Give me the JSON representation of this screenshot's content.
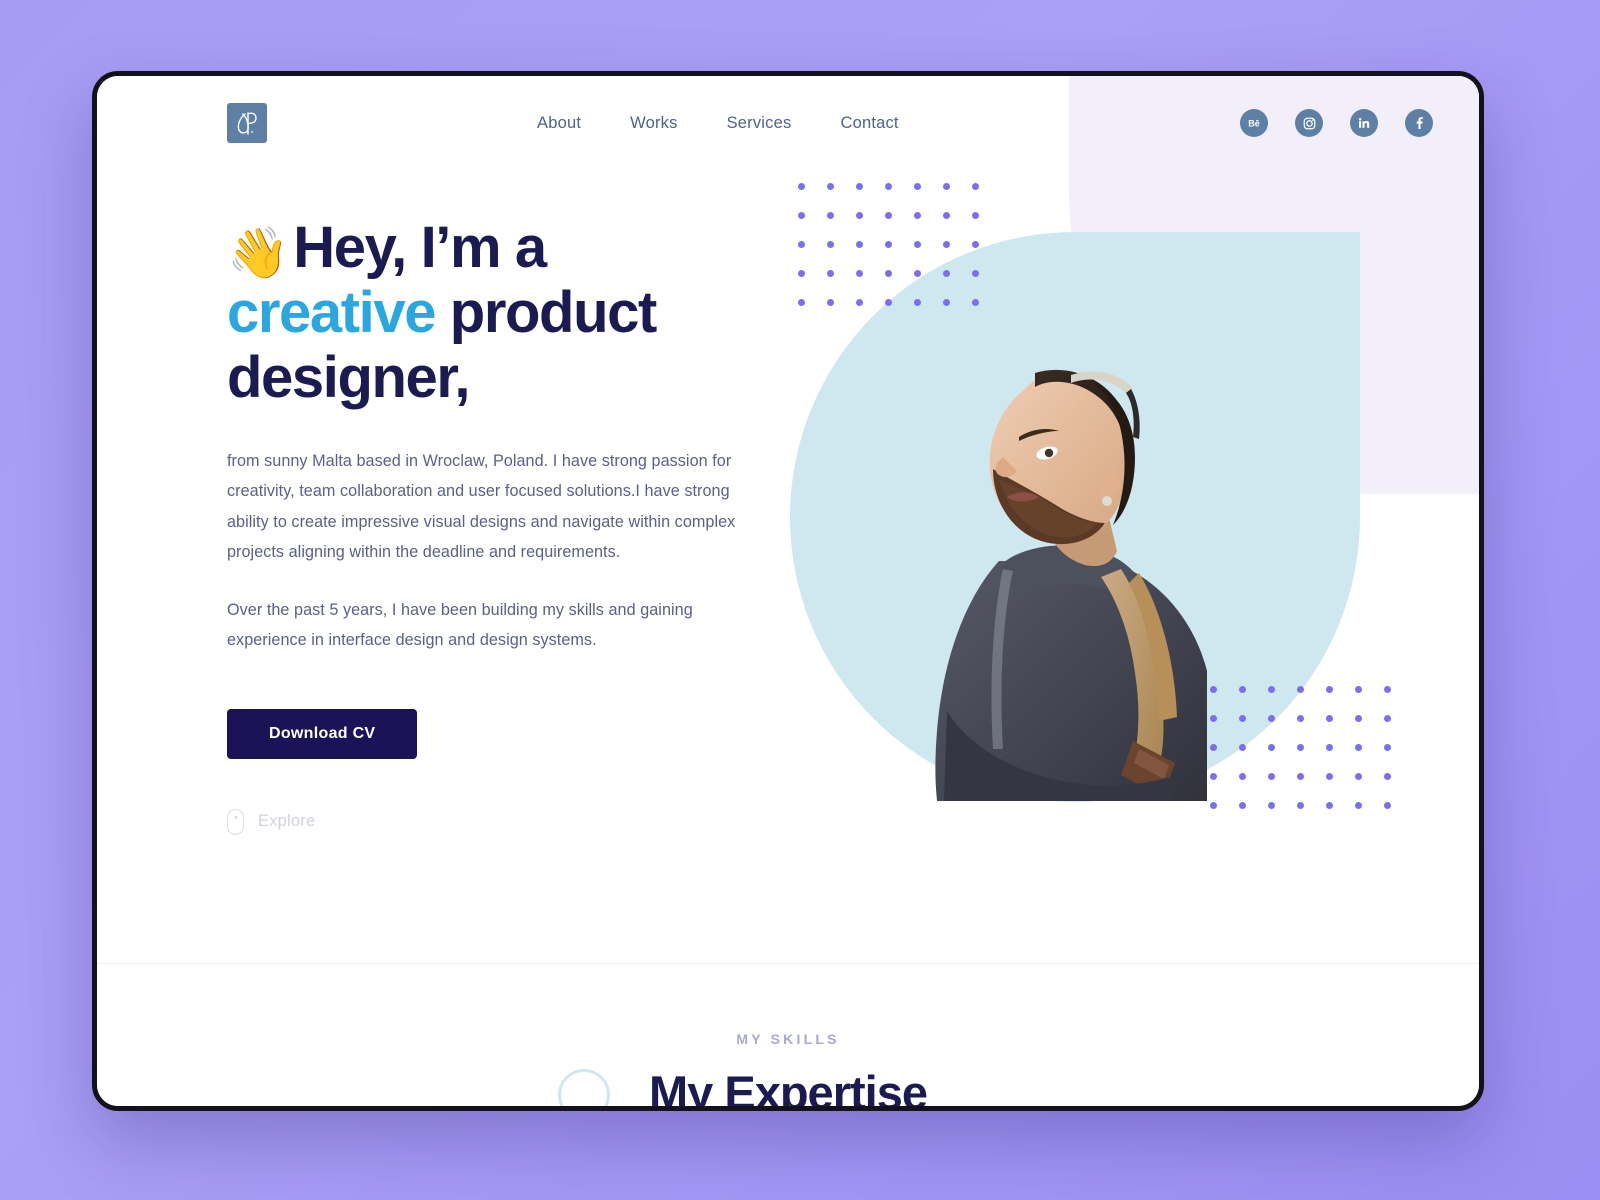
{
  "page": {
    "background_color": "#a79cf5",
    "frame_border_color": "#13121c"
  },
  "theme": {
    "navy": "#1b1b52",
    "button_navy": "#1b1355",
    "accent_cyan": "#2aa6e0",
    "body_text": "#5b5f8a",
    "nav_text": "#51628f",
    "social_icon_bg": "#5e80a5",
    "pale_blue_shape": "#cfe7ef",
    "lavender_blob": "#f2effb",
    "dot_purple": "#7b6ef0",
    "muted_gray": "#d2d2de"
  },
  "header": {
    "logo_name": "monogram-logo",
    "nav": [
      {
        "label": "About"
      },
      {
        "label": "Works"
      },
      {
        "label": "Services"
      },
      {
        "label": "Contact"
      }
    ],
    "social": [
      {
        "name": "behance-icon",
        "label": "Behance"
      },
      {
        "name": "instagram-icon",
        "label": "Instagram"
      },
      {
        "name": "linkedin-icon",
        "label": "LinkedIn"
      },
      {
        "name": "facebook-icon",
        "label": "Facebook"
      }
    ]
  },
  "hero": {
    "wave_emoji": "👋",
    "heading_line1": "Hey, I’m a",
    "heading_accent": "creative",
    "heading_after_accent": " product",
    "heading_line3": "designer,",
    "paragraph_1": "from sunny Malta based in Wroclaw, Poland. I have strong passion for creativity, team collaboration and user focused solutions.I have strong ability to create impressive visual designs and navigate within complex projects aligning within the deadline and requirements.",
    "paragraph_2": "Over the past 5 years, I have been building my skills and gaining experience in interface design and design systems.",
    "cta_label": "Download CV",
    "explore_label": "Explore",
    "photo_alt": "bearded man with backpack looking upward"
  },
  "skills_section": {
    "eyebrow": "MY SKILLS",
    "heading": "My Expertise"
  }
}
